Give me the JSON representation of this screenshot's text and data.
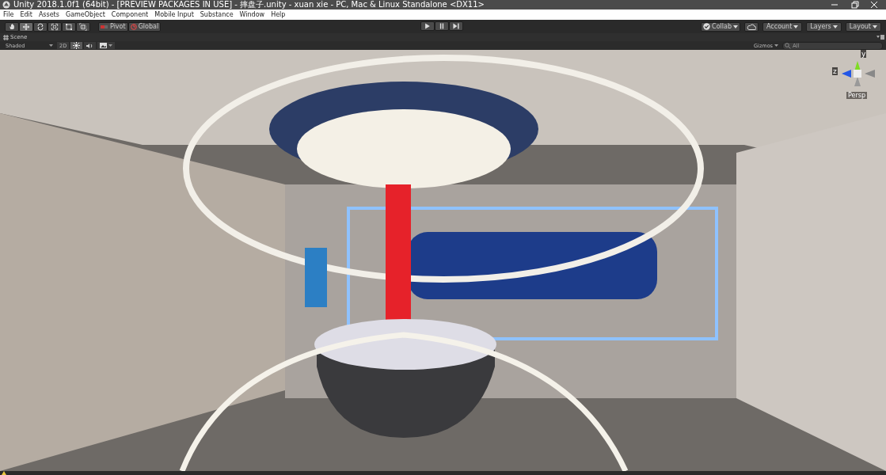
{
  "window": {
    "title": "Unity 2018.1.0f1 (64bit) - [PREVIEW PACKAGES IN USE] - 摔盘子.unity - xuan xie - PC, Mac & Linux Standalone <DX11>"
  },
  "menu": [
    "File",
    "Edit",
    "Assets",
    "GameObject",
    "Component",
    "Mobile Input",
    "Substance",
    "Window",
    "Help"
  ],
  "tools": [
    {
      "kind": "hand",
      "selected": false
    },
    {
      "kind": "move",
      "selected": true
    },
    {
      "kind": "rotate",
      "selected": false
    },
    {
      "kind": "scale",
      "selected": false
    },
    {
      "kind": "rect",
      "selected": false
    },
    {
      "kind": "transform",
      "selected": false
    }
  ],
  "pivot": [
    "Pivot",
    "Global"
  ],
  "play": [
    {
      "kind": "play"
    },
    {
      "kind": "pause"
    },
    {
      "kind": "step"
    }
  ],
  "right_buttons": [
    {
      "kind": "collab",
      "label": "Collab"
    },
    {
      "kind": "cloud"
    },
    {
      "kind": "dropdown",
      "label": "Account"
    },
    {
      "kind": "dropdown",
      "label": "Layers"
    },
    {
      "kind": "dropdown",
      "label": "Layout"
    }
  ],
  "scene_tab": {
    "label": "Scene"
  },
  "scene_toolbar": {
    "shading": "Shaded",
    "mode_2d": "2D",
    "lighting": true,
    "audio": false,
    "gizmos": "Gizmos",
    "search_placeholder": "All"
  },
  "gizmo": {
    "y": "y",
    "z": "z",
    "projection": "Persp"
  }
}
